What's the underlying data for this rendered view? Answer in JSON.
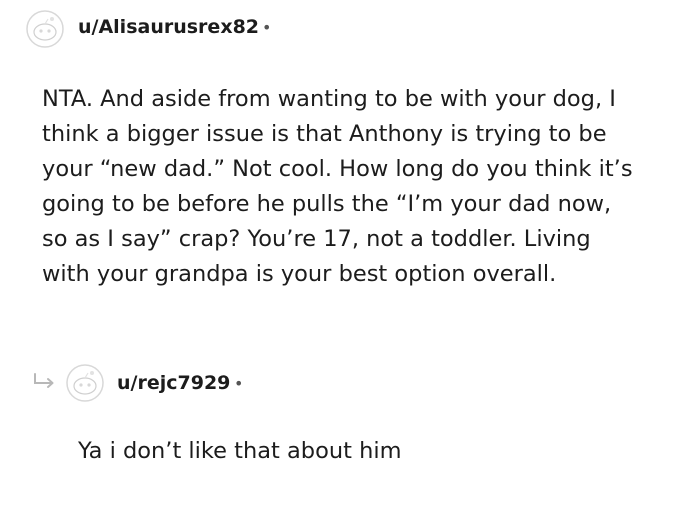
{
  "comments": [
    {
      "username": "u/Alisaurusrex82",
      "separator": "•",
      "lines": [
        "NTA. And aside from wanting to be with your dog, I",
        "think a bigger issue is that Anthony is trying to be",
        "your “new dad.” Not cool. How long do you think it’s",
        "going to be before he pulls the “I’m your dad now,",
        "so as I say” crap? You’re 17, not a toddler. Living",
        "with your grandpa is your best option overall."
      ]
    },
    {
      "username": "u/rejc7929",
      "separator": "•",
      "lines": [
        "Ya i don’t like that about him"
      ]
    }
  ],
  "icons": {
    "avatar": "snoo-avatar-icon",
    "reply": "reply-arrow-icon"
  },
  "colors": {
    "text": "#1c1c1c",
    "icon_outline": "#d8d8d8",
    "reply_arrow": "#b8b8b8"
  }
}
